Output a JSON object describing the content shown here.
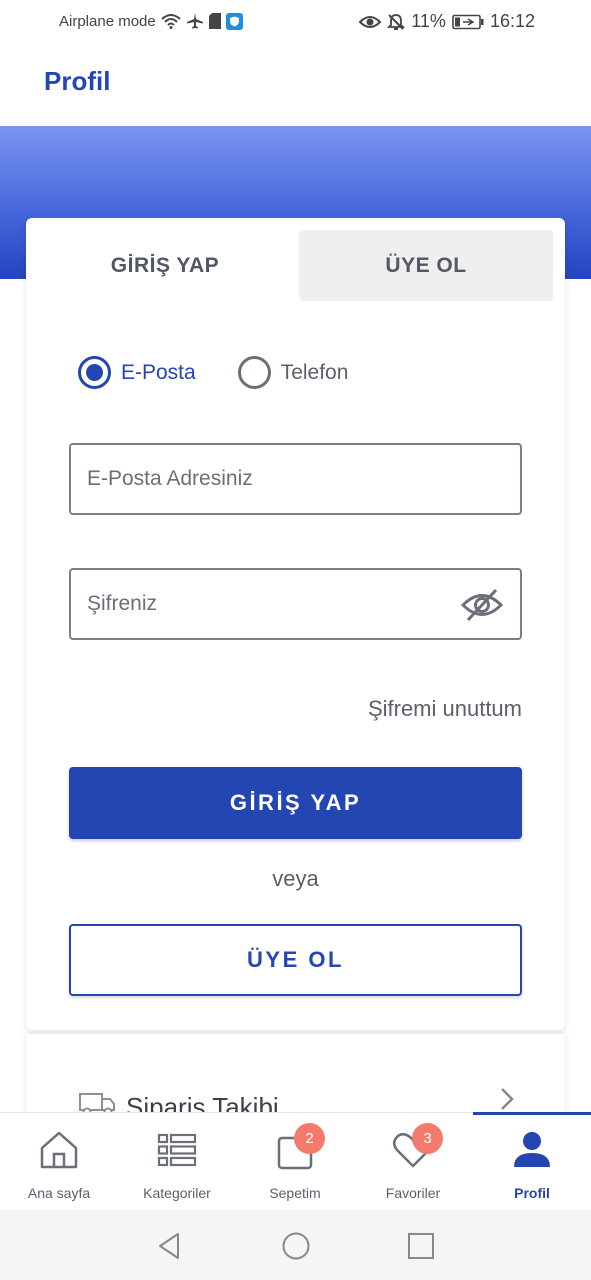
{
  "status_bar": {
    "airplane_mode_text": "Airplane mode",
    "battery_percent": "11%",
    "time": "16:12"
  },
  "header": {
    "title": "Profil"
  },
  "auth_tabs": {
    "login": "GİRİŞ YAP",
    "register": "ÜYE OL"
  },
  "login_method": {
    "options": [
      "E-Posta",
      "Telefon"
    ],
    "selected": "E-Posta"
  },
  "form": {
    "email_placeholder": "E-Posta Adresiniz",
    "password_placeholder": "Şifreniz",
    "forgot_password": "Şifremi unuttum",
    "login_button": "GİRİŞ YAP",
    "or_text": "veya",
    "register_button": "ÜYE OL"
  },
  "order_tracking": {
    "label": "Sipariş Takibi"
  },
  "bottom_nav": {
    "items": [
      {
        "label": "Ana sayfa",
        "icon": "home-icon"
      },
      {
        "label": "Kategoriler",
        "icon": "list-icon"
      },
      {
        "label": "Sepetim",
        "icon": "cart-icon",
        "badge": "2"
      },
      {
        "label": "Favoriler",
        "icon": "heart-icon",
        "badge": "3"
      },
      {
        "label": "Profil",
        "icon": "user-icon"
      }
    ],
    "active": "Profil"
  },
  "colors": {
    "primary": "#2446b3",
    "badge": "#f47b6b"
  }
}
